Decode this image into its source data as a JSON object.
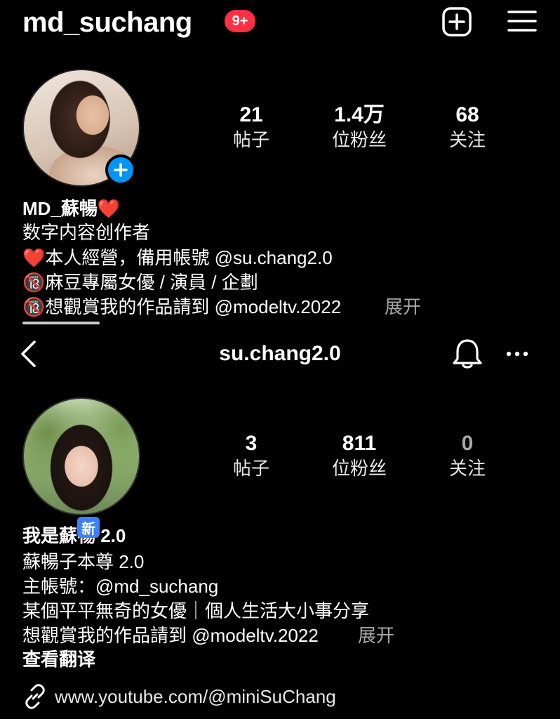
{
  "profile1": {
    "username": "md_suchang",
    "notif_badge": "9+",
    "stats": [
      {
        "value": "21",
        "label": "帖子"
      },
      {
        "value": "1.4万",
        "label": "位粉丝"
      },
      {
        "value": "68",
        "label": "关注"
      }
    ],
    "display_name": "MD_蘇暢❤️",
    "category": "数字内容创作者",
    "bio": [
      "❤️本人經營，備用帳號 @su.chang2.0",
      "🔞麻豆專屬女優 / 演員 / 企劃",
      "🔞想觀賞我的作品請到 @modeltv.2022"
    ],
    "expand": "展开"
  },
  "profile2": {
    "username": "su.chang2.0",
    "stats": [
      {
        "value": "3",
        "label": "帖子"
      },
      {
        "value": "811",
        "label": "位粉丝"
      },
      {
        "value": "0",
        "label": "关注"
      }
    ],
    "new_tag": "新",
    "display_name": "我是蘇暢 2.0",
    "bio": [
      "蘇暢子本尊 2.0",
      "主帳號：@md_suchang",
      "某個平平無奇的女優｜個人生活大小事分享",
      "想觀賞我的作品請到 @modeltv.2022"
    ],
    "expand": "展开",
    "see_translation": "查看翻译",
    "link": "www.youtube.com/@miniSuChang"
  },
  "icons": {
    "create": "plus-square-icon",
    "menu": "hamburger-icon",
    "back": "chevron-left-icon",
    "bell": "bell-icon",
    "more": "ellipsis-icon",
    "link": "link-icon"
  },
  "colors": {
    "background": "#000000",
    "badge": "#ff3040",
    "accent_blue": "#0095f6",
    "muted": "#a8a8a8"
  }
}
